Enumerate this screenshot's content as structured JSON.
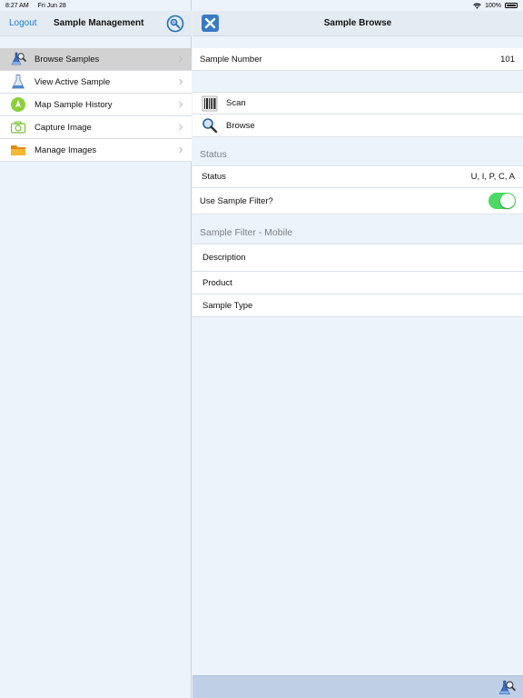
{
  "status_bar": {
    "time": "8:27 AM",
    "date": "Fri Jun 28",
    "battery": "100%"
  },
  "master": {
    "logout_label": "Logout",
    "title": "Sample Management",
    "items": [
      {
        "label": "Browse Samples",
        "icon": "sample-flask-magnifier-icon",
        "selected": true
      },
      {
        "label": "View Active Sample",
        "icon": "flask-icon",
        "selected": false
      },
      {
        "label": "Map Sample History",
        "icon": "map-pin-icon",
        "selected": false
      },
      {
        "label": "Capture Image",
        "icon": "camera-icon",
        "selected": false
      },
      {
        "label": "Manage Images",
        "icon": "folder-icon",
        "selected": false
      }
    ]
  },
  "detail": {
    "title": "Sample Browse",
    "sample_number_label": "Sample Number",
    "sample_number_value": "101",
    "scan_label": "Scan",
    "browse_label": "Browse",
    "status_section": "Status",
    "status_label": "Status",
    "status_value": "U, I, P, C, A",
    "use_filter_label": "Use Sample Filter?",
    "use_filter_on": true,
    "filter_section": "Sample Filter - Mobile",
    "filter_fields": [
      "Description",
      "Product",
      "Sample Type"
    ]
  },
  "colors": {
    "accent": "#1a7fd8",
    "toggle_on": "#4cd964",
    "close_button": "#3a7ac4",
    "bottom_bar": "#bfd0e6"
  }
}
